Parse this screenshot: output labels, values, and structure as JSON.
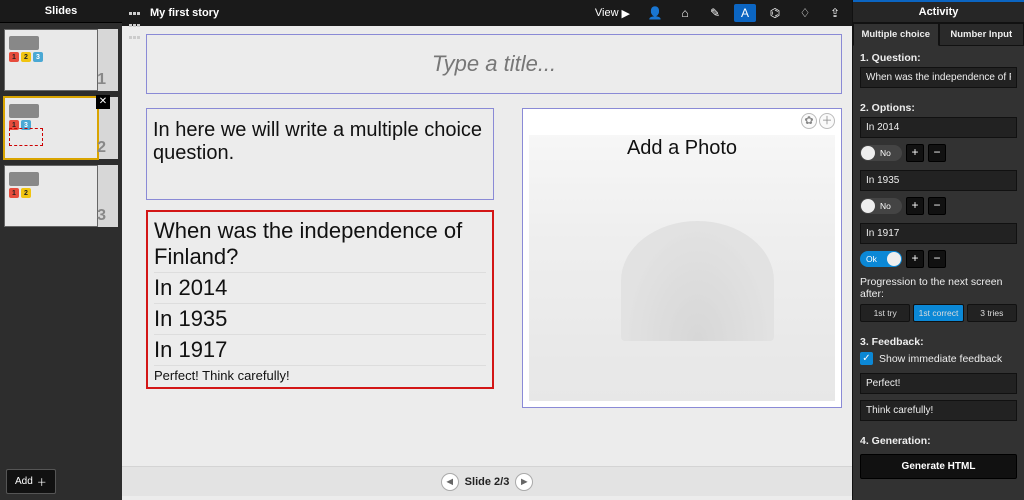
{
  "slidesPanel": {
    "header": "Slides",
    "addLabel": "Add"
  },
  "slides": [
    {
      "num": "1"
    },
    {
      "num": "2",
      "selected": true,
      "closable": true,
      "dashed": true
    },
    {
      "num": "3"
    }
  ],
  "topbar": {
    "title": "My first story",
    "view": "View"
  },
  "canvas": {
    "titlePlaceholder": "Type a title...",
    "textBlock": "In here we will write a multiple choice question.",
    "question": "When was the independence of Finland?",
    "options": [
      "In 2014",
      "In 1935",
      "In 1917"
    ],
    "feedback": "Perfect! Think carefully!",
    "photoLabel": "Add a Photo"
  },
  "pager": {
    "label": "Slide 2/3"
  },
  "activity": {
    "header": "Activity",
    "tabs": {
      "mc": "Multiple choice",
      "ni": "Number Input"
    },
    "q_label": "1. Question:",
    "q_value": "When was the independence of Finland?",
    "opts_label": "2. Options:",
    "opts": [
      {
        "text": "In 2014",
        "state": "No",
        "ok": false
      },
      {
        "text": "In 1935",
        "state": "No",
        "ok": false
      },
      {
        "text": "In 1917",
        "state": "Ok",
        "ok": true
      }
    ],
    "prog_label": "Progression to the next screen after:",
    "prog": {
      "a": "1st try",
      "b": "1st correct",
      "c": "3 tries"
    },
    "fb_label": "3. Feedback:",
    "fb_check": "Show immediate feedback",
    "fb_pos": "Perfect!",
    "fb_neg": "Think carefully!",
    "gen_label": "4. Generation:",
    "gen_btn": "Generate HTML"
  }
}
